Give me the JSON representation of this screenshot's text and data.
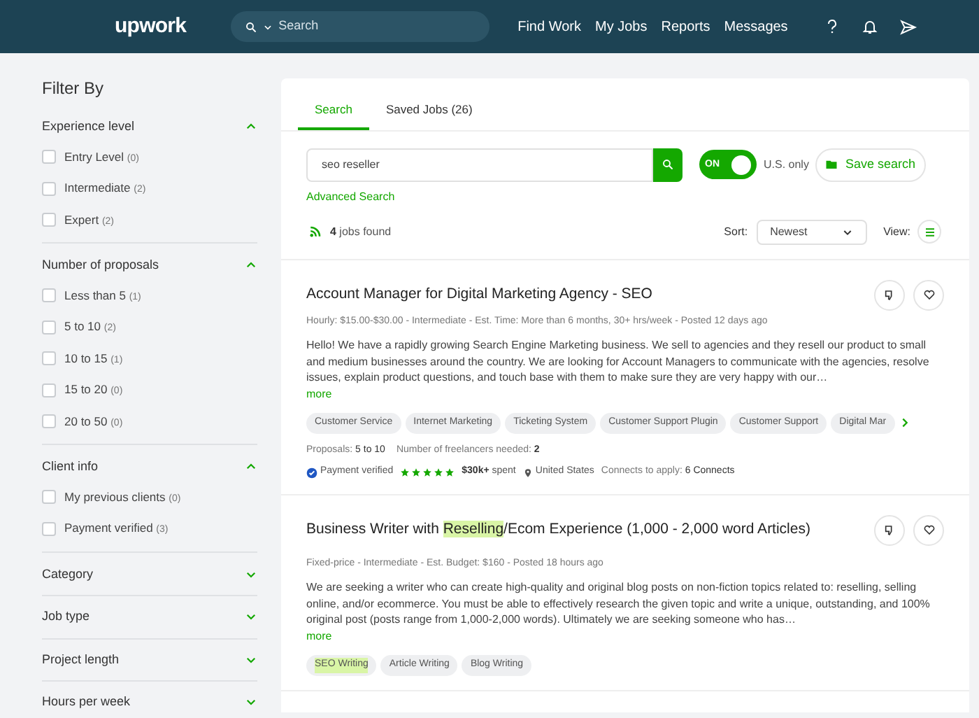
{
  "header": {
    "logo": "upwork",
    "search_placeholder": "Search",
    "nav": [
      "Find Work",
      "My Jobs",
      "Reports",
      "Messages"
    ]
  },
  "sidebar": {
    "title": "Filter By",
    "sections": [
      {
        "title": "Experience level",
        "expanded": true,
        "options": [
          {
            "label": "Entry Level",
            "count": "(0)",
            "checked": false
          },
          {
            "label": "Intermediate",
            "count": "(2)",
            "checked": false
          },
          {
            "label": "Expert",
            "count": "(2)",
            "checked": false
          }
        ]
      },
      {
        "title": "Number of proposals",
        "expanded": true,
        "options": [
          {
            "label": "Less than 5",
            "count": "(1)",
            "checked": false
          },
          {
            "label": "5 to 10",
            "count": "(2)",
            "checked": false
          },
          {
            "label": "10 to 15",
            "count": "(1)",
            "checked": false
          },
          {
            "label": "15 to 20",
            "count": "(0)",
            "checked": false
          },
          {
            "label": "20 to 50",
            "count": "(0)",
            "checked": false
          }
        ]
      },
      {
        "title": "Client info",
        "expanded": true,
        "options": [
          {
            "label": "My previous clients",
            "count": "(0)",
            "checked": false
          },
          {
            "label": "Payment verified",
            "count": "(3)",
            "checked": false
          }
        ]
      },
      {
        "title": "Category",
        "expanded": false
      },
      {
        "title": "Job type",
        "expanded": false
      },
      {
        "title": "Project length",
        "expanded": false
      },
      {
        "title": "Hours per week",
        "expanded": false
      }
    ]
  },
  "tabs": [
    {
      "label": "Search",
      "selected": true
    },
    {
      "label": "Saved Jobs (26)",
      "selected": false
    }
  ],
  "search": {
    "value": "seo reseller",
    "toggle_label": "ON",
    "us_only": true,
    "us_only_label": "U.S. only",
    "save_search": "Save search",
    "advanced": "Advanced Search"
  },
  "results": {
    "count": "4",
    "count_label": "jobs found",
    "sort_label": "Sort:",
    "sort_value": "Newest",
    "view_label": "View:"
  },
  "jobs": [
    {
      "title_parts": [
        {
          "text": "Account Manager for Digital Marketing Agency - SEO",
          "highlighted": false
        }
      ],
      "meta": "Hourly: $15.00-$30.00 - Intermediate - Est. Time: More than 6 months, 30+ hrs/week - Posted 12 days ago",
      "description": "Hello! We have a rapidly growing Search Engine Marketing business. We sell to agencies and they resell our product to small and medium businesses around the country. We are looking for Account Managers to communicate with the agencies, resolve issues, explain product questions, and touch base with them to make sure they are very happy with our…",
      "more": "more",
      "skills": [
        {
          "label": "Customer Service",
          "highlighted": false
        },
        {
          "label": "Internet Marketing",
          "highlighted": false
        },
        {
          "label": "Ticketing System",
          "highlighted": false
        },
        {
          "label": "Customer Support Plugin",
          "highlighted": false
        },
        {
          "label": "Customer Support",
          "highlighted": false
        },
        {
          "label": "Digital Mar",
          "highlighted": false
        }
      ],
      "details": {
        "proposals_label": "Proposals:",
        "proposals": "5 to 10",
        "freelancers_label": "Number of freelancers needed:",
        "freelancers": "2",
        "payment": "Payment verified",
        "stars": 5,
        "spent": "$30k+",
        "spent_label": "spent",
        "location": "United States",
        "connects_label": "Connects to apply:",
        "connects": "6 Connects"
      }
    },
    {
      "title_parts": [
        {
          "text": "Business Writer with ",
          "highlighted": false
        },
        {
          "text": "Reselling",
          "highlighted": true
        },
        {
          "text": "/Ecom Experience (1,000 - 2,000 word Articles)",
          "highlighted": false
        }
      ],
      "meta": "Fixed-price - Intermediate - Est. Budget: $160 - Posted 18 hours ago",
      "description": "We are seeking a writer who can create high-quality and original blog posts on non-fiction topics related to: reselling, selling online, and/or ecommerce. You must be able to effectively research the given topic and write a unique, outstanding, and 100% original post (posts range from 1,000-2,000 words). Ultimately we are seeking someone who has…",
      "more": "more",
      "skills": [
        {
          "label": "SEO Writing",
          "highlighted": true
        },
        {
          "label": "Article Writing",
          "highlighted": false
        },
        {
          "label": "Blog Writing",
          "highlighted": false
        }
      ]
    }
  ]
}
